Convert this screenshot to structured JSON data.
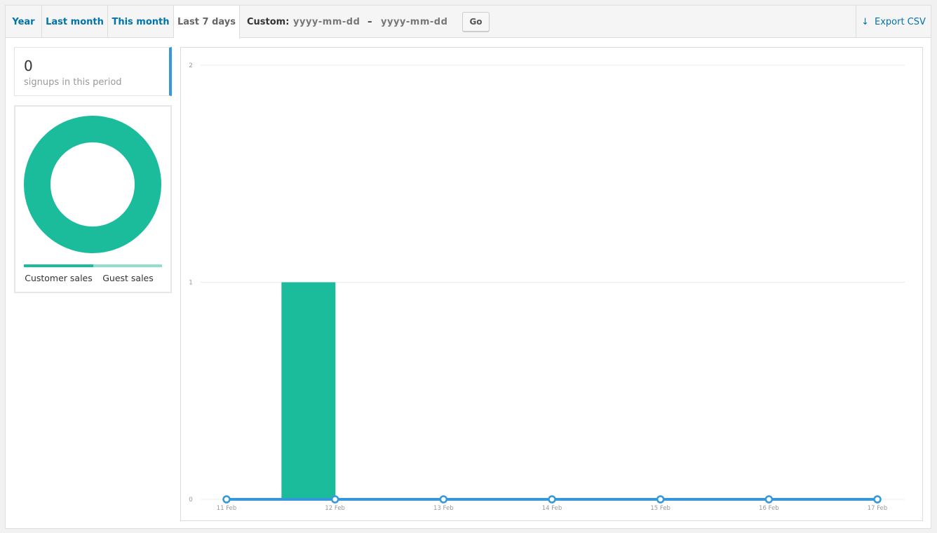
{
  "tabs": [
    {
      "label": "Year"
    },
    {
      "label": "Last month"
    },
    {
      "label": "This month"
    },
    {
      "label": "Last 7 days",
      "active": true
    }
  ],
  "custom": {
    "label": "Custom:",
    "start_placeholder": "yyyy-mm-dd",
    "separator": "–",
    "end_placeholder": "yyyy-mm-dd",
    "go_label": "Go"
  },
  "export": {
    "icon": "download-arrow-icon",
    "label": "Export CSV"
  },
  "summary": {
    "value": "0",
    "label": "signups in this period",
    "accent": "#3498db"
  },
  "pie": {
    "legend": [
      {
        "label": "Customer sales",
        "color": "#1abc9c"
      },
      {
        "label": "Guest sales",
        "color": "#8fdece"
      }
    ]
  },
  "chart_data": {
    "type": "bar",
    "categories": [
      "11 Feb",
      "12 Feb",
      "13 Feb",
      "14 Feb",
      "15 Feb",
      "16 Feb",
      "17 Feb"
    ],
    "series": [
      {
        "values": [
          0,
          1,
          0,
          0,
          0,
          0,
          0
        ],
        "color": "#1abc9c",
        "kind": "bar"
      },
      {
        "values": [
          0,
          0,
          0,
          0,
          0,
          0,
          0
        ],
        "color": "#3498db",
        "kind": "line"
      }
    ],
    "yticks": [
      "2",
      "1",
      "0"
    ],
    "ylim": [
      0,
      2
    ],
    "grid": true,
    "pie_slices": [
      {
        "value": 1,
        "color": "#1abc9c"
      },
      {
        "value": 0,
        "color": "#8fdece"
      }
    ]
  }
}
